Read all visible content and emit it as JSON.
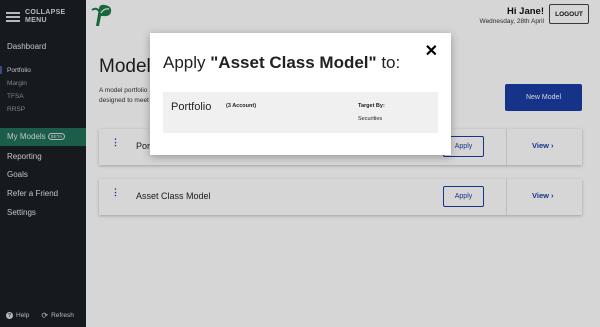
{
  "sidebar": {
    "collapse_label": "COLLAPSE MENU",
    "items": [
      {
        "label": "Dashboard"
      },
      {
        "label": "My Models",
        "badge": "BETA"
      },
      {
        "label": "Reporting"
      },
      {
        "label": "Goals"
      },
      {
        "label": "Refer a Friend"
      },
      {
        "label": "Settings"
      }
    ],
    "accounts": [
      {
        "label": "Portfolio"
      },
      {
        "label": "Margin"
      },
      {
        "label": "TFSA"
      },
      {
        "label": "RRSP"
      }
    ],
    "help_label": "Help",
    "refresh_label": "Refresh"
  },
  "header": {
    "greeting": "Hi Jane!",
    "date": "Wednesday, 28th April",
    "logout_label": "LOGOUT"
  },
  "page": {
    "title": "Model Portfolios",
    "description_line1": "A model portfolio",
    "description_line2": "designed to meet",
    "new_model_label": "New Model"
  },
  "models": [
    {
      "name": "Portfolio",
      "apply_label": "Apply",
      "view_label": "View ›"
    },
    {
      "name": "Asset Class Model",
      "apply_label": "Apply",
      "view_label": "View ›"
    }
  ],
  "modal": {
    "title_prefix": "Apply ",
    "title_model": "\"Asset Class Model\"",
    "title_suffix": " to:",
    "close_glyph": "✕",
    "row": {
      "name": "Portfolio",
      "count": "(3 Account)",
      "target_label": "Target By:",
      "target_value": "Securities"
    }
  },
  "colors": {
    "sidebar_bg": "#1b1f24",
    "active_item": "#1f6f56",
    "accent_blue": "#1a3fa4",
    "logo_green": "#1f7a4a"
  }
}
